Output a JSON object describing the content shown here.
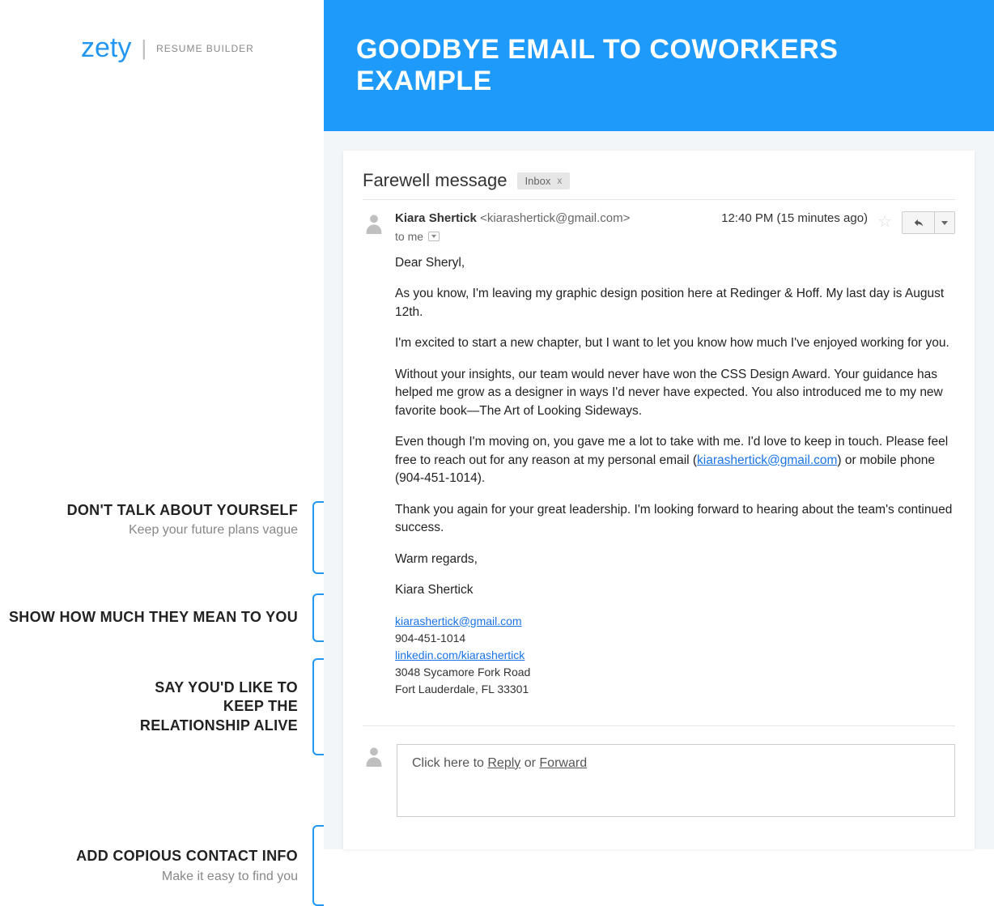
{
  "brand": {
    "logo": "zety",
    "divider": "|",
    "sub": "RESUME BUILDER"
  },
  "banner": "GOODBYE EMAIL TO COWORKERS EXAMPLE",
  "tips": [
    {
      "title": "DON'T TALK ABOUT YOURSELF",
      "sub": "Keep your future plans vague"
    },
    {
      "title": "SHOW HOW MUCH THEY MEAN TO YOU",
      "sub": ""
    },
    {
      "title": "SAY YOU'D LIKE TO KEEP THE RELATIONSHIP ALIVE",
      "sub": ""
    },
    {
      "title": "ADD COPIOUS CONTACT INFO",
      "sub": "Make it easy to find you"
    }
  ],
  "email": {
    "subject": "Farewell message",
    "label": "Inbox",
    "label_close": "x",
    "from_name": "Kiara Shertick",
    "from_email": "<kiarashertick@gmail.com>",
    "to": "to me",
    "time": "12:40 PM (15 minutes ago)",
    "greeting": "Dear Sheryl,",
    "p1": "As you know, I'm leaving my graphic design position here at Redinger & Hoff. My last day is August 12th.",
    "p2": "I'm excited to start a new chapter, but I want to let you know how much I've enjoyed working for you.",
    "p3": "Without your insights, our team would never have won the CSS Design Award. Your guidance has helped me grow as a designer in ways I'd never have expected. You also introduced me to my new favorite book—The Art of Looking Sideways.",
    "p4_a": "Even though I'm moving on, you gave me a lot to take with me. I'd love to keep in touch.  Please feel free to reach out for any reason at my personal email (",
    "p4_link": "kiarashertick@gmail.com",
    "p4_b": ") or mobile phone (904-451-1014).",
    "p5": "Thank you again for your great leadership. I'm looking forward to hearing about the team's continued success.",
    "closing": "Warm regards,",
    "signature": "Kiara Shertick",
    "sig_email": "kiarashertick@gmail.com",
    "sig_phone": "904-451-1014",
    "sig_linkedin": "linkedin.com/kiarashertick",
    "sig_addr1": "3048 Sycamore Fork Road",
    "sig_addr2": "Fort Lauderdale, FL 33301",
    "reply_prefix": "Click here to ",
    "reply_reply": "Reply",
    "reply_or": " or ",
    "reply_forward": "Forward"
  }
}
